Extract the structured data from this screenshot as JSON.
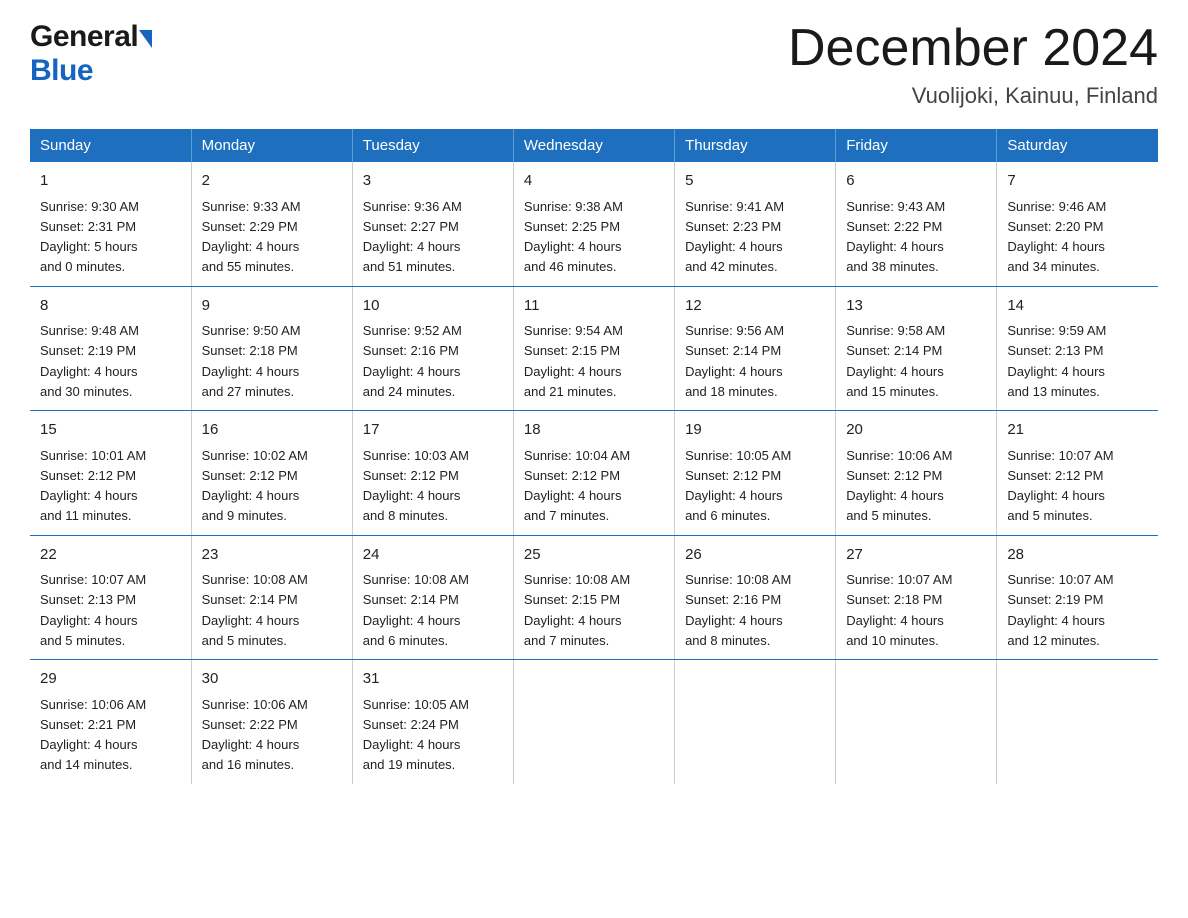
{
  "logo": {
    "general": "General",
    "blue": "Blue"
  },
  "title": "December 2024",
  "subtitle": "Vuolijoki, Kainuu, Finland",
  "days_of_week": [
    "Sunday",
    "Monday",
    "Tuesday",
    "Wednesday",
    "Thursday",
    "Friday",
    "Saturday"
  ],
  "weeks": [
    [
      {
        "day": "1",
        "sunrise": "Sunrise: 9:30 AM",
        "sunset": "Sunset: 2:31 PM",
        "daylight": "Daylight: 5 hours",
        "daylight2": "and 0 minutes."
      },
      {
        "day": "2",
        "sunrise": "Sunrise: 9:33 AM",
        "sunset": "Sunset: 2:29 PM",
        "daylight": "Daylight: 4 hours",
        "daylight2": "and 55 minutes."
      },
      {
        "day": "3",
        "sunrise": "Sunrise: 9:36 AM",
        "sunset": "Sunset: 2:27 PM",
        "daylight": "Daylight: 4 hours",
        "daylight2": "and 51 minutes."
      },
      {
        "day": "4",
        "sunrise": "Sunrise: 9:38 AM",
        "sunset": "Sunset: 2:25 PM",
        "daylight": "Daylight: 4 hours",
        "daylight2": "and 46 minutes."
      },
      {
        "day": "5",
        "sunrise": "Sunrise: 9:41 AM",
        "sunset": "Sunset: 2:23 PM",
        "daylight": "Daylight: 4 hours",
        "daylight2": "and 42 minutes."
      },
      {
        "day": "6",
        "sunrise": "Sunrise: 9:43 AM",
        "sunset": "Sunset: 2:22 PM",
        "daylight": "Daylight: 4 hours",
        "daylight2": "and 38 minutes."
      },
      {
        "day": "7",
        "sunrise": "Sunrise: 9:46 AM",
        "sunset": "Sunset: 2:20 PM",
        "daylight": "Daylight: 4 hours",
        "daylight2": "and 34 minutes."
      }
    ],
    [
      {
        "day": "8",
        "sunrise": "Sunrise: 9:48 AM",
        "sunset": "Sunset: 2:19 PM",
        "daylight": "Daylight: 4 hours",
        "daylight2": "and 30 minutes."
      },
      {
        "day": "9",
        "sunrise": "Sunrise: 9:50 AM",
        "sunset": "Sunset: 2:18 PM",
        "daylight": "Daylight: 4 hours",
        "daylight2": "and 27 minutes."
      },
      {
        "day": "10",
        "sunrise": "Sunrise: 9:52 AM",
        "sunset": "Sunset: 2:16 PM",
        "daylight": "Daylight: 4 hours",
        "daylight2": "and 24 minutes."
      },
      {
        "day": "11",
        "sunrise": "Sunrise: 9:54 AM",
        "sunset": "Sunset: 2:15 PM",
        "daylight": "Daylight: 4 hours",
        "daylight2": "and 21 minutes."
      },
      {
        "day": "12",
        "sunrise": "Sunrise: 9:56 AM",
        "sunset": "Sunset: 2:14 PM",
        "daylight": "Daylight: 4 hours",
        "daylight2": "and 18 minutes."
      },
      {
        "day": "13",
        "sunrise": "Sunrise: 9:58 AM",
        "sunset": "Sunset: 2:14 PM",
        "daylight": "Daylight: 4 hours",
        "daylight2": "and 15 minutes."
      },
      {
        "day": "14",
        "sunrise": "Sunrise: 9:59 AM",
        "sunset": "Sunset: 2:13 PM",
        "daylight": "Daylight: 4 hours",
        "daylight2": "and 13 minutes."
      }
    ],
    [
      {
        "day": "15",
        "sunrise": "Sunrise: 10:01 AM",
        "sunset": "Sunset: 2:12 PM",
        "daylight": "Daylight: 4 hours",
        "daylight2": "and 11 minutes."
      },
      {
        "day": "16",
        "sunrise": "Sunrise: 10:02 AM",
        "sunset": "Sunset: 2:12 PM",
        "daylight": "Daylight: 4 hours",
        "daylight2": "and 9 minutes."
      },
      {
        "day": "17",
        "sunrise": "Sunrise: 10:03 AM",
        "sunset": "Sunset: 2:12 PM",
        "daylight": "Daylight: 4 hours",
        "daylight2": "and 8 minutes."
      },
      {
        "day": "18",
        "sunrise": "Sunrise: 10:04 AM",
        "sunset": "Sunset: 2:12 PM",
        "daylight": "Daylight: 4 hours",
        "daylight2": "and 7 minutes."
      },
      {
        "day": "19",
        "sunrise": "Sunrise: 10:05 AM",
        "sunset": "Sunset: 2:12 PM",
        "daylight": "Daylight: 4 hours",
        "daylight2": "and 6 minutes."
      },
      {
        "day": "20",
        "sunrise": "Sunrise: 10:06 AM",
        "sunset": "Sunset: 2:12 PM",
        "daylight": "Daylight: 4 hours",
        "daylight2": "and 5 minutes."
      },
      {
        "day": "21",
        "sunrise": "Sunrise: 10:07 AM",
        "sunset": "Sunset: 2:12 PM",
        "daylight": "Daylight: 4 hours",
        "daylight2": "and 5 minutes."
      }
    ],
    [
      {
        "day": "22",
        "sunrise": "Sunrise: 10:07 AM",
        "sunset": "Sunset: 2:13 PM",
        "daylight": "Daylight: 4 hours",
        "daylight2": "and 5 minutes."
      },
      {
        "day": "23",
        "sunrise": "Sunrise: 10:08 AM",
        "sunset": "Sunset: 2:14 PM",
        "daylight": "Daylight: 4 hours",
        "daylight2": "and 5 minutes."
      },
      {
        "day": "24",
        "sunrise": "Sunrise: 10:08 AM",
        "sunset": "Sunset: 2:14 PM",
        "daylight": "Daylight: 4 hours",
        "daylight2": "and 6 minutes."
      },
      {
        "day": "25",
        "sunrise": "Sunrise: 10:08 AM",
        "sunset": "Sunset: 2:15 PM",
        "daylight": "Daylight: 4 hours",
        "daylight2": "and 7 minutes."
      },
      {
        "day": "26",
        "sunrise": "Sunrise: 10:08 AM",
        "sunset": "Sunset: 2:16 PM",
        "daylight": "Daylight: 4 hours",
        "daylight2": "and 8 minutes."
      },
      {
        "day": "27",
        "sunrise": "Sunrise: 10:07 AM",
        "sunset": "Sunset: 2:18 PM",
        "daylight": "Daylight: 4 hours",
        "daylight2": "and 10 minutes."
      },
      {
        "day": "28",
        "sunrise": "Sunrise: 10:07 AM",
        "sunset": "Sunset: 2:19 PM",
        "daylight": "Daylight: 4 hours",
        "daylight2": "and 12 minutes."
      }
    ],
    [
      {
        "day": "29",
        "sunrise": "Sunrise: 10:06 AM",
        "sunset": "Sunset: 2:21 PM",
        "daylight": "Daylight: 4 hours",
        "daylight2": "and 14 minutes."
      },
      {
        "day": "30",
        "sunrise": "Sunrise: 10:06 AM",
        "sunset": "Sunset: 2:22 PM",
        "daylight": "Daylight: 4 hours",
        "daylight2": "and 16 minutes."
      },
      {
        "day": "31",
        "sunrise": "Sunrise: 10:05 AM",
        "sunset": "Sunset: 2:24 PM",
        "daylight": "Daylight: 4 hours",
        "daylight2": "and 19 minutes."
      },
      null,
      null,
      null,
      null
    ]
  ]
}
